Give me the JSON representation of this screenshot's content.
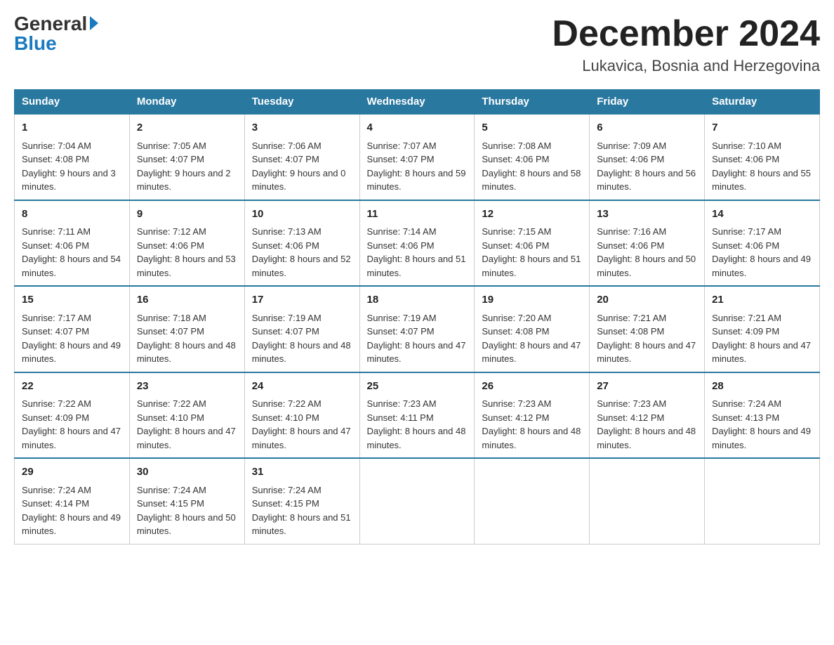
{
  "header": {
    "logo_general": "General",
    "logo_blue": "Blue",
    "month_title": "December 2024",
    "location": "Lukavica, Bosnia and Herzegovina"
  },
  "days_of_week": [
    "Sunday",
    "Monday",
    "Tuesday",
    "Wednesday",
    "Thursday",
    "Friday",
    "Saturday"
  ],
  "weeks": [
    [
      {
        "day": "1",
        "sunrise": "7:04 AM",
        "sunset": "4:08 PM",
        "daylight": "9 hours and 3 minutes."
      },
      {
        "day": "2",
        "sunrise": "7:05 AM",
        "sunset": "4:07 PM",
        "daylight": "9 hours and 2 minutes."
      },
      {
        "day": "3",
        "sunrise": "7:06 AM",
        "sunset": "4:07 PM",
        "daylight": "9 hours and 0 minutes."
      },
      {
        "day": "4",
        "sunrise": "7:07 AM",
        "sunset": "4:07 PM",
        "daylight": "8 hours and 59 minutes."
      },
      {
        "day": "5",
        "sunrise": "7:08 AM",
        "sunset": "4:06 PM",
        "daylight": "8 hours and 58 minutes."
      },
      {
        "day": "6",
        "sunrise": "7:09 AM",
        "sunset": "4:06 PM",
        "daylight": "8 hours and 56 minutes."
      },
      {
        "day": "7",
        "sunrise": "7:10 AM",
        "sunset": "4:06 PM",
        "daylight": "8 hours and 55 minutes."
      }
    ],
    [
      {
        "day": "8",
        "sunrise": "7:11 AM",
        "sunset": "4:06 PM",
        "daylight": "8 hours and 54 minutes."
      },
      {
        "day": "9",
        "sunrise": "7:12 AM",
        "sunset": "4:06 PM",
        "daylight": "8 hours and 53 minutes."
      },
      {
        "day": "10",
        "sunrise": "7:13 AM",
        "sunset": "4:06 PM",
        "daylight": "8 hours and 52 minutes."
      },
      {
        "day": "11",
        "sunrise": "7:14 AM",
        "sunset": "4:06 PM",
        "daylight": "8 hours and 51 minutes."
      },
      {
        "day": "12",
        "sunrise": "7:15 AM",
        "sunset": "4:06 PM",
        "daylight": "8 hours and 51 minutes."
      },
      {
        "day": "13",
        "sunrise": "7:16 AM",
        "sunset": "4:06 PM",
        "daylight": "8 hours and 50 minutes."
      },
      {
        "day": "14",
        "sunrise": "7:17 AM",
        "sunset": "4:06 PM",
        "daylight": "8 hours and 49 minutes."
      }
    ],
    [
      {
        "day": "15",
        "sunrise": "7:17 AM",
        "sunset": "4:07 PM",
        "daylight": "8 hours and 49 minutes."
      },
      {
        "day": "16",
        "sunrise": "7:18 AM",
        "sunset": "4:07 PM",
        "daylight": "8 hours and 48 minutes."
      },
      {
        "day": "17",
        "sunrise": "7:19 AM",
        "sunset": "4:07 PM",
        "daylight": "8 hours and 48 minutes."
      },
      {
        "day": "18",
        "sunrise": "7:19 AM",
        "sunset": "4:07 PM",
        "daylight": "8 hours and 47 minutes."
      },
      {
        "day": "19",
        "sunrise": "7:20 AM",
        "sunset": "4:08 PM",
        "daylight": "8 hours and 47 minutes."
      },
      {
        "day": "20",
        "sunrise": "7:21 AM",
        "sunset": "4:08 PM",
        "daylight": "8 hours and 47 minutes."
      },
      {
        "day": "21",
        "sunrise": "7:21 AM",
        "sunset": "4:09 PM",
        "daylight": "8 hours and 47 minutes."
      }
    ],
    [
      {
        "day": "22",
        "sunrise": "7:22 AM",
        "sunset": "4:09 PM",
        "daylight": "8 hours and 47 minutes."
      },
      {
        "day": "23",
        "sunrise": "7:22 AM",
        "sunset": "4:10 PM",
        "daylight": "8 hours and 47 minutes."
      },
      {
        "day": "24",
        "sunrise": "7:22 AM",
        "sunset": "4:10 PM",
        "daylight": "8 hours and 47 minutes."
      },
      {
        "day": "25",
        "sunrise": "7:23 AM",
        "sunset": "4:11 PM",
        "daylight": "8 hours and 48 minutes."
      },
      {
        "day": "26",
        "sunrise": "7:23 AM",
        "sunset": "4:12 PM",
        "daylight": "8 hours and 48 minutes."
      },
      {
        "day": "27",
        "sunrise": "7:23 AM",
        "sunset": "4:12 PM",
        "daylight": "8 hours and 48 minutes."
      },
      {
        "day": "28",
        "sunrise": "7:24 AM",
        "sunset": "4:13 PM",
        "daylight": "8 hours and 49 minutes."
      }
    ],
    [
      {
        "day": "29",
        "sunrise": "7:24 AM",
        "sunset": "4:14 PM",
        "daylight": "8 hours and 49 minutes."
      },
      {
        "day": "30",
        "sunrise": "7:24 AM",
        "sunset": "4:15 PM",
        "daylight": "8 hours and 50 minutes."
      },
      {
        "day": "31",
        "sunrise": "7:24 AM",
        "sunset": "4:15 PM",
        "daylight": "8 hours and 51 minutes."
      },
      null,
      null,
      null,
      null
    ]
  ],
  "labels": {
    "sunrise": "Sunrise:",
    "sunset": "Sunset:",
    "daylight": "Daylight:"
  }
}
